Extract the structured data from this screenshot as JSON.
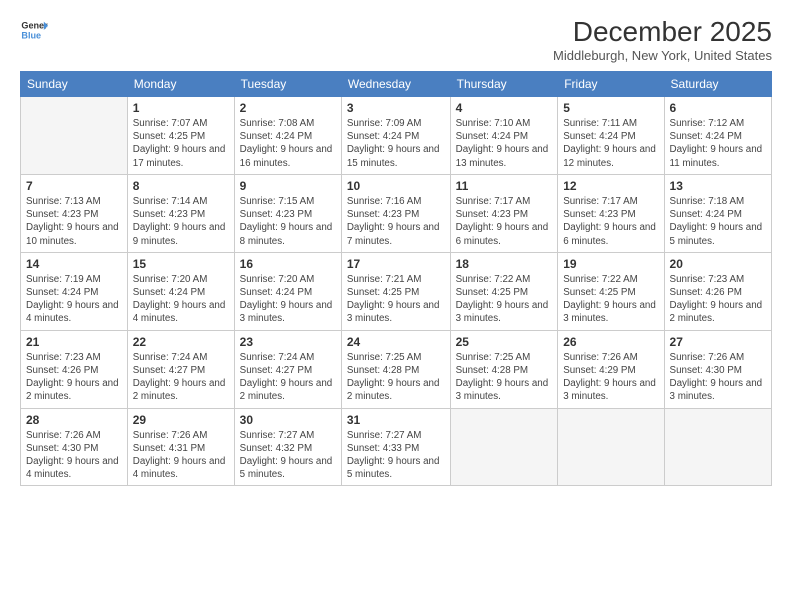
{
  "header": {
    "logo_line1": "General",
    "logo_line2": "Blue",
    "month_title": "December 2025",
    "location": "Middleburgh, New York, United States"
  },
  "weekdays": [
    "Sunday",
    "Monday",
    "Tuesday",
    "Wednesday",
    "Thursday",
    "Friday",
    "Saturday"
  ],
  "weeks": [
    [
      {
        "day": "",
        "empty": true
      },
      {
        "day": "1",
        "sunrise": "7:07 AM",
        "sunset": "4:25 PM",
        "daylight": "9 hours and 17 minutes."
      },
      {
        "day": "2",
        "sunrise": "7:08 AM",
        "sunset": "4:24 PM",
        "daylight": "9 hours and 16 minutes."
      },
      {
        "day": "3",
        "sunrise": "7:09 AM",
        "sunset": "4:24 PM",
        "daylight": "9 hours and 15 minutes."
      },
      {
        "day": "4",
        "sunrise": "7:10 AM",
        "sunset": "4:24 PM",
        "daylight": "9 hours and 13 minutes."
      },
      {
        "day": "5",
        "sunrise": "7:11 AM",
        "sunset": "4:24 PM",
        "daylight": "9 hours and 12 minutes."
      },
      {
        "day": "6",
        "sunrise": "7:12 AM",
        "sunset": "4:24 PM",
        "daylight": "9 hours and 11 minutes."
      }
    ],
    [
      {
        "day": "7",
        "sunrise": "7:13 AM",
        "sunset": "4:23 PM",
        "daylight": "9 hours and 10 minutes."
      },
      {
        "day": "8",
        "sunrise": "7:14 AM",
        "sunset": "4:23 PM",
        "daylight": "9 hours and 9 minutes."
      },
      {
        "day": "9",
        "sunrise": "7:15 AM",
        "sunset": "4:23 PM",
        "daylight": "9 hours and 8 minutes."
      },
      {
        "day": "10",
        "sunrise": "7:16 AM",
        "sunset": "4:23 PM",
        "daylight": "9 hours and 7 minutes."
      },
      {
        "day": "11",
        "sunrise": "7:17 AM",
        "sunset": "4:23 PM",
        "daylight": "9 hours and 6 minutes."
      },
      {
        "day": "12",
        "sunrise": "7:17 AM",
        "sunset": "4:23 PM",
        "daylight": "9 hours and 6 minutes."
      },
      {
        "day": "13",
        "sunrise": "7:18 AM",
        "sunset": "4:24 PM",
        "daylight": "9 hours and 5 minutes."
      }
    ],
    [
      {
        "day": "14",
        "sunrise": "7:19 AM",
        "sunset": "4:24 PM",
        "daylight": "9 hours and 4 minutes."
      },
      {
        "day": "15",
        "sunrise": "7:20 AM",
        "sunset": "4:24 PM",
        "daylight": "9 hours and 4 minutes."
      },
      {
        "day": "16",
        "sunrise": "7:20 AM",
        "sunset": "4:24 PM",
        "daylight": "9 hours and 3 minutes."
      },
      {
        "day": "17",
        "sunrise": "7:21 AM",
        "sunset": "4:25 PM",
        "daylight": "9 hours and 3 minutes."
      },
      {
        "day": "18",
        "sunrise": "7:22 AM",
        "sunset": "4:25 PM",
        "daylight": "9 hours and 3 minutes."
      },
      {
        "day": "19",
        "sunrise": "7:22 AM",
        "sunset": "4:25 PM",
        "daylight": "9 hours and 3 minutes."
      },
      {
        "day": "20",
        "sunrise": "7:23 AM",
        "sunset": "4:26 PM",
        "daylight": "9 hours and 2 minutes."
      }
    ],
    [
      {
        "day": "21",
        "sunrise": "7:23 AM",
        "sunset": "4:26 PM",
        "daylight": "9 hours and 2 minutes."
      },
      {
        "day": "22",
        "sunrise": "7:24 AM",
        "sunset": "4:27 PM",
        "daylight": "9 hours and 2 minutes."
      },
      {
        "day": "23",
        "sunrise": "7:24 AM",
        "sunset": "4:27 PM",
        "daylight": "9 hours and 2 minutes."
      },
      {
        "day": "24",
        "sunrise": "7:25 AM",
        "sunset": "4:28 PM",
        "daylight": "9 hours and 2 minutes."
      },
      {
        "day": "25",
        "sunrise": "7:25 AM",
        "sunset": "4:28 PM",
        "daylight": "9 hours and 3 minutes."
      },
      {
        "day": "26",
        "sunrise": "7:26 AM",
        "sunset": "4:29 PM",
        "daylight": "9 hours and 3 minutes."
      },
      {
        "day": "27",
        "sunrise": "7:26 AM",
        "sunset": "4:30 PM",
        "daylight": "9 hours and 3 minutes."
      }
    ],
    [
      {
        "day": "28",
        "sunrise": "7:26 AM",
        "sunset": "4:30 PM",
        "daylight": "9 hours and 4 minutes."
      },
      {
        "day": "29",
        "sunrise": "7:26 AM",
        "sunset": "4:31 PM",
        "daylight": "9 hours and 4 minutes."
      },
      {
        "day": "30",
        "sunrise": "7:27 AM",
        "sunset": "4:32 PM",
        "daylight": "9 hours and 5 minutes."
      },
      {
        "day": "31",
        "sunrise": "7:27 AM",
        "sunset": "4:33 PM",
        "daylight": "9 hours and 5 minutes."
      },
      {
        "day": "",
        "empty": true
      },
      {
        "day": "",
        "empty": true
      },
      {
        "day": "",
        "empty": true
      }
    ]
  ]
}
